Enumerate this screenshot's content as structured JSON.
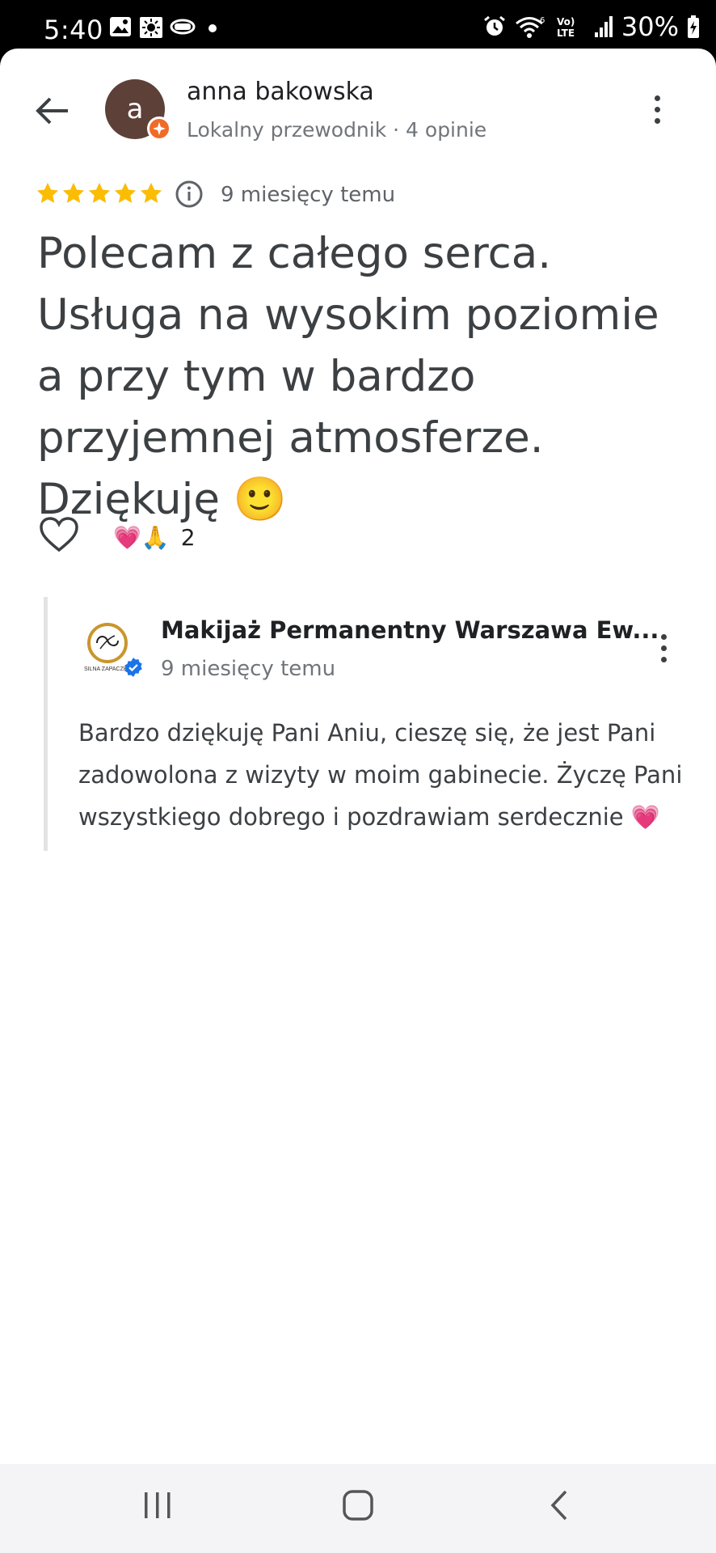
{
  "status_bar": {
    "time": "5:40",
    "battery": "30%",
    "network_label": "Vo) LTE",
    "wifi_label": "6"
  },
  "reviewer": {
    "avatar_letter": "a",
    "name": "anna bakowska",
    "meta": "Lokalny przewodnik · 4 opinie",
    "rating": 5
  },
  "review": {
    "date": "9 miesięcy temu",
    "text": "Polecam z całego serca. Usługa na wysokim poziomie a przy tym w bardzo przyjemnej atmosferze. Dziękuję 🙂",
    "reactions": "💗🙏",
    "reaction_count": "2"
  },
  "owner_reply": {
    "name": "Makijaż Permanentny Warszawa Ew...",
    "date": "9 miesięcy temu",
    "logo_caption": "SILNA ZAPACZKI",
    "text": "Bardzo dziękuję Pani Aniu, cieszę się, że jest Pani zadowolona z wizyty w moim gabinecie. Życzę Pani wszystkiego dobrego i pozdrawiam serdecznie 💗"
  },
  "colors": {
    "star": "#fbbc04",
    "guide_badge": "#f06a28",
    "verified": "#1a73e8",
    "avatar": "#5d4037"
  }
}
